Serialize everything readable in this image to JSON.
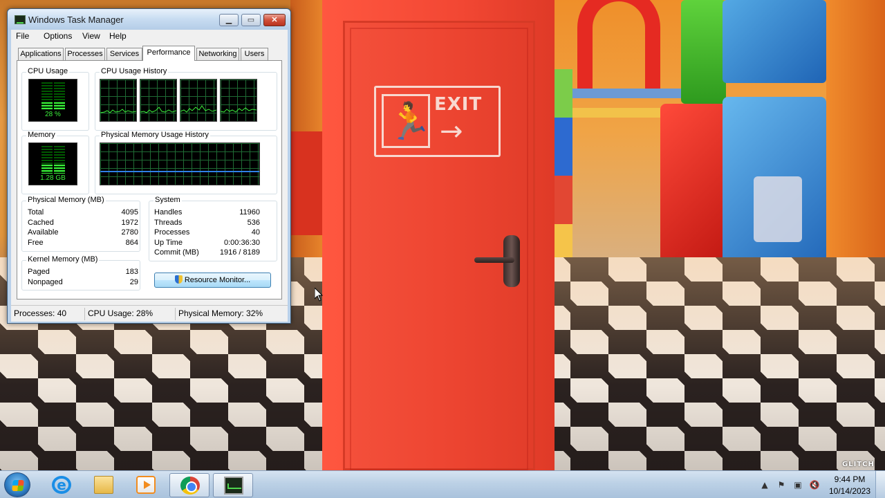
{
  "window": {
    "title": "Windows Task Manager",
    "menu": [
      "File",
      "Options",
      "View",
      "Help"
    ],
    "tabs": [
      "Applications",
      "Processes",
      "Services",
      "Performance",
      "Networking",
      "Users"
    ],
    "active_tab": "Performance"
  },
  "performance": {
    "cpu_usage": {
      "title": "CPU Usage",
      "label": "28 %",
      "percent": 28
    },
    "cpu_history": {
      "title": "CPU Usage History"
    },
    "memory": {
      "title": "Memory",
      "label": "1.28 GB",
      "percent": 32
    },
    "memory_history": {
      "title": "Physical Memory Usage History"
    },
    "physical_memory": {
      "title": "Physical Memory (MB)",
      "rows": [
        {
          "key": "Total",
          "value": "4095"
        },
        {
          "key": "Cached",
          "value": "1972"
        },
        {
          "key": "Available",
          "value": "2780"
        },
        {
          "key": "Free",
          "value": "864"
        }
      ]
    },
    "kernel_memory": {
      "title": "Kernel Memory (MB)",
      "rows": [
        {
          "key": "Paged",
          "value": "183"
        },
        {
          "key": "Nonpaged",
          "value": "29"
        }
      ]
    },
    "system": {
      "title": "System",
      "rows": [
        {
          "key": "Handles",
          "value": "11960"
        },
        {
          "key": "Threads",
          "value": "536"
        },
        {
          "key": "Processes",
          "value": "40"
        },
        {
          "key": "Up Time",
          "value": "0:00:36:30"
        },
        {
          "key": "Commit (MB)",
          "value": "1916 / 8189"
        }
      ]
    },
    "resource_monitor_button": "Resource Monitor..."
  },
  "status": {
    "processes": "Processes: 40",
    "cpu": "CPU Usage: 28%",
    "memory": "Physical Memory: 32%"
  },
  "desktop": {
    "exit_sign": "EXIT",
    "exit_arrow": "→",
    "exit_runner": "🏃",
    "watermark": "GLITCH"
  },
  "taskbar": {
    "clock_time": "9:44 PM",
    "clock_date": "10/14/2023",
    "tray_expand": "▲"
  },
  "colors": {
    "meter_green": "#3cf03c",
    "graph_grid": "#1f6b34",
    "memory_line": "#2f7fe6",
    "door_red": "#f24733"
  }
}
